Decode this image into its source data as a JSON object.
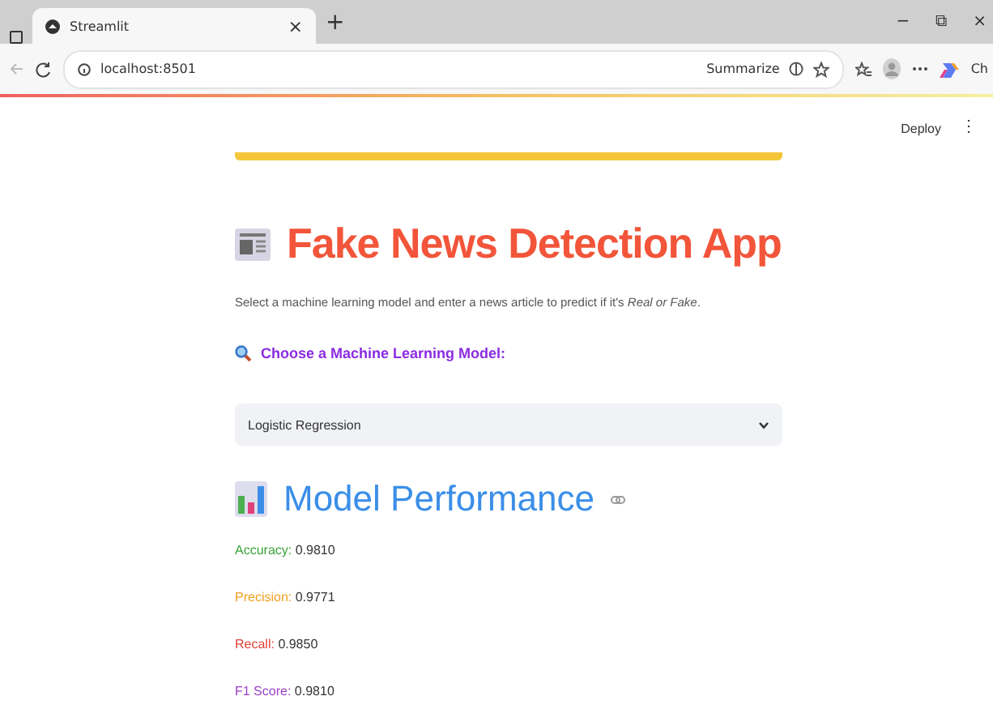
{
  "browser": {
    "tab_title": "Streamlit",
    "tab_close": "×",
    "new_tab": "+",
    "url": "localhost:8501",
    "summarize": "Summarize",
    "window_controls": [
      "−",
      "⧉",
      "×"
    ],
    "copilot_label": "Ch"
  },
  "toolbar": {
    "deploy": "Deploy",
    "menu": "⋮"
  },
  "app": {
    "title": "Fake News Detection App",
    "intro": "Select a machine learning model and enter a news article to predict if it's *Real or Fake*.",
    "model_label": "Choose a Machine Learning Model:",
    "model_value": "Logistic Regression",
    "performance_title": "Model Performance",
    "metrics": [
      {
        "label": "Accuracy:",
        "value": "0.9810",
        "color": "#3aa33a"
      },
      {
        "label": "Precision:",
        "value": "0.9771",
        "color": "#f0a020"
      },
      {
        "label": "Recall:",
        "value": "0.9850",
        "color": "#e0443a"
      },
      {
        "label": "F1 Score:",
        "value": "0.9810",
        "color": "#9b3fc8"
      }
    ]
  }
}
